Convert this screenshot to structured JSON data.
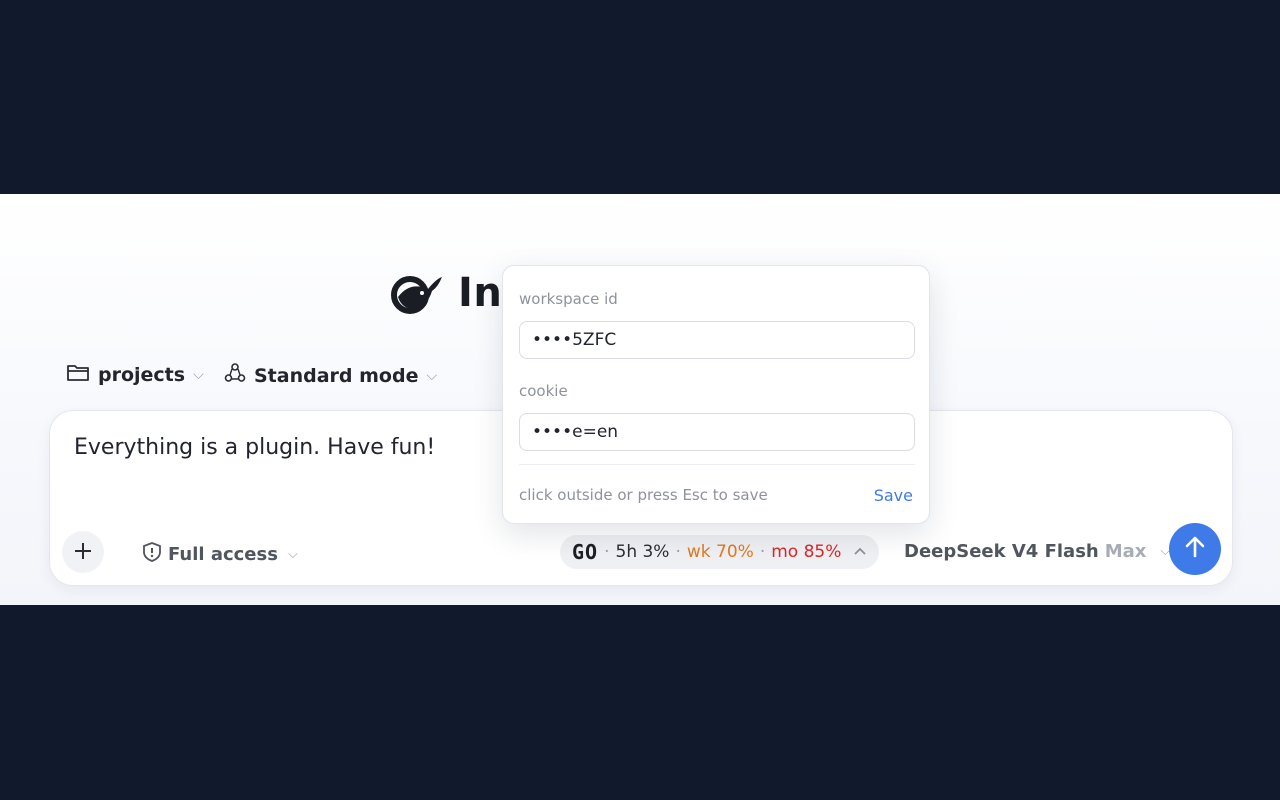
{
  "header": {
    "logo_icon": "whale-logo-icon",
    "title": "Int"
  },
  "selectors": {
    "project_icon": "folder-icon",
    "project_label": "projects",
    "mode_icon": "recycle-icon",
    "mode_label": "Standard mode"
  },
  "composer": {
    "text": "Everything is a plugin. Have fun!",
    "plus_icon": "plus-icon",
    "access_icon": "shield-icon",
    "access_label": "Full access",
    "usage": {
      "provider_badge": "GO",
      "five_hour": "5h 3%",
      "week": "wk 70%",
      "month": "mo 85%",
      "separator": "·"
    },
    "model_name": "DeepSeek V4 Flash",
    "model_effort": "Max",
    "send_icon": "arrow-up-icon"
  },
  "popover": {
    "workspace_label": "workspace id",
    "workspace_value": "••••5ZFC",
    "cookie_label": "cookie",
    "cookie_value": "••••e=en",
    "hint": "click outside or press Esc to save",
    "save_label": "Save"
  },
  "colors": {
    "page_background": "#111a2d",
    "accent": "#3f7be8",
    "warn": "#e07a1f",
    "danger": "#dc2626"
  }
}
